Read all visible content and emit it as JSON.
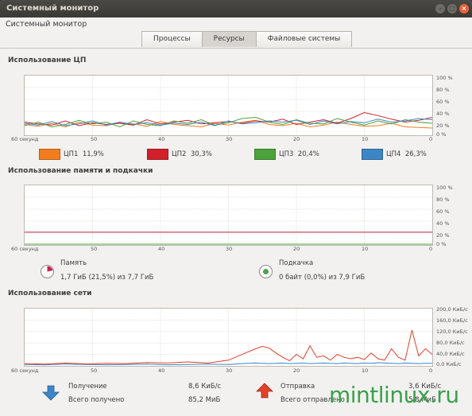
{
  "window": {
    "title": "Системный монитор",
    "app_title": "Системный монитор"
  },
  "tabs": [
    {
      "label": "Процессы",
      "active": false
    },
    {
      "label": "Ресурсы",
      "active": true
    },
    {
      "label": "Файловые системы",
      "active": false
    }
  ],
  "cpu": {
    "title": "Использование ЦП",
    "x_ticks": [
      "60 секунд",
      "50",
      "40",
      "30",
      "20",
      "10",
      "0"
    ],
    "y_ticks": [
      "100 %",
      "80 %",
      "60 %",
      "40 %",
      "20 %",
      "0 %"
    ],
    "legend": [
      {
        "name": "ЦП1",
        "value": "11,9%",
        "color": "#f17d1f"
      },
      {
        "name": "ЦП2",
        "value": "30,3%",
        "color": "#d2202a"
      },
      {
        "name": "ЦП3",
        "value": "20,4%",
        "color": "#4ca33b"
      },
      {
        "name": "ЦП4",
        "value": "26,3%",
        "color": "#3d86c6"
      }
    ],
    "chart_data": {
      "type": "line",
      "x": [
        60,
        58,
        56,
        54,
        52,
        50,
        48,
        46,
        44,
        42,
        40,
        38,
        36,
        34,
        32,
        30,
        28,
        26,
        24,
        22,
        20,
        18,
        16,
        14,
        12,
        10,
        8,
        6,
        4,
        2,
        0
      ],
      "ylim": [
        0,
        100
      ],
      "series": [
        {
          "name": "ЦП1",
          "values": [
            18,
            15,
            20,
            14,
            22,
            17,
            16,
            21,
            19,
            15,
            23,
            18,
            16,
            14,
            20,
            17,
            22,
            25,
            18,
            16,
            20,
            14,
            17,
            22,
            18,
            15,
            16,
            20,
            14,
            13,
            12
          ]
        },
        {
          "name": "ЦП2",
          "values": [
            22,
            19,
            17,
            24,
            16,
            21,
            18,
            20,
            17,
            26,
            19,
            22,
            25,
            19,
            21,
            23,
            20,
            24,
            22,
            27,
            18,
            22,
            26,
            20,
            28,
            38,
            33,
            27,
            22,
            25,
            30
          ]
        },
        {
          "name": "ЦП3",
          "values": [
            16,
            22,
            14,
            18,
            25,
            19,
            22,
            14,
            24,
            18,
            16,
            24,
            20,
            26,
            17,
            21,
            28,
            30,
            22,
            18,
            26,
            20,
            19,
            28,
            22,
            17,
            24,
            19,
            26,
            22,
            20
          ]
        },
        {
          "name": "ЦП4",
          "values": [
            20,
            17,
            23,
            16,
            19,
            24,
            17,
            22,
            18,
            21,
            17,
            20,
            18,
            22,
            16,
            24,
            19,
            21,
            24,
            22,
            25,
            18,
            24,
            19,
            23,
            21,
            27,
            22,
            24,
            28,
            26
          ]
        }
      ]
    }
  },
  "memory": {
    "title": "Использование памяти и подкачки",
    "x_ticks": [
      "60 секунд",
      "50",
      "40",
      "30",
      "20",
      "10",
      "0"
    ],
    "y_ticks": [
      "100 %",
      "80 %",
      "60 %",
      "40 %",
      "20 %",
      "0 %"
    ],
    "memory_label": "Память",
    "memory_value": "1,7 ГиБ (21,5%) из 7,7 ГиБ",
    "memory_color": "#c5234f",
    "memory_percent": 21.5,
    "swap_label": "Подкачка",
    "swap_value": "0 байт (0,0%) из 7,9 ГиБ",
    "swap_color": "#4ca33b",
    "swap_percent": 0.0
  },
  "network": {
    "title": "Использование сети",
    "x_ticks": [
      "60 секунд",
      "50",
      "40",
      "30",
      "20",
      "10",
      "0"
    ],
    "y_ticks": [
      "200,0 КиБ/с",
      "160,0 КиБ/с",
      "120,0 КиБ/с",
      "80,0 КиБ/с",
      "40,0 КиБ/с",
      "0,0 КиБ/с"
    ],
    "receive_label": "Получение",
    "receive_rate": "8,6 КиБ/с",
    "total_received_label": "Всего получено",
    "total_received": "85,2 МиБ",
    "send_label": "Отправка",
    "send_rate": "3,6 КиБ/с",
    "total_sent_label": "Всего отправлено",
    "total_sent": "5,8 МиБ",
    "receive_color": "#3d86c6",
    "send_color": "#e3402a",
    "chart_data": {
      "type": "line",
      "x": [
        60,
        57,
        54,
        51,
        48,
        45,
        42,
        39,
        36,
        33,
        30,
        28,
        26,
        25,
        24,
        23,
        22,
        21,
        20,
        19,
        18,
        17,
        16,
        15,
        14,
        13,
        12,
        11,
        10,
        9,
        8,
        7,
        6,
        5,
        4,
        3,
        2,
        1,
        0
      ],
      "ylim": [
        0,
        200
      ],
      "series": [
        {
          "name": "Получение",
          "values": [
            5,
            4,
            6,
            5,
            4,
            5,
            6,
            4,
            5,
            6,
            5,
            8,
            10,
            9,
            8,
            9,
            10,
            8,
            9,
            10,
            8,
            9,
            10,
            9,
            8,
            10,
            9,
            8,
            10,
            9,
            11,
            10,
            9,
            8,
            10,
            9,
            8,
            9,
            9
          ]
        },
        {
          "name": "Отправка",
          "values": [
            8,
            6,
            10,
            7,
            9,
            8,
            12,
            10,
            14,
            10,
            20,
            40,
            60,
            68,
            62,
            45,
            30,
            18,
            40,
            25,
            70,
            30,
            35,
            20,
            40,
            30,
            25,
            30,
            22,
            45,
            25,
            20,
            60,
            30,
            20,
            125,
            35,
            60,
            40
          ]
        }
      ]
    }
  },
  "watermark": "mintlinux.ru"
}
